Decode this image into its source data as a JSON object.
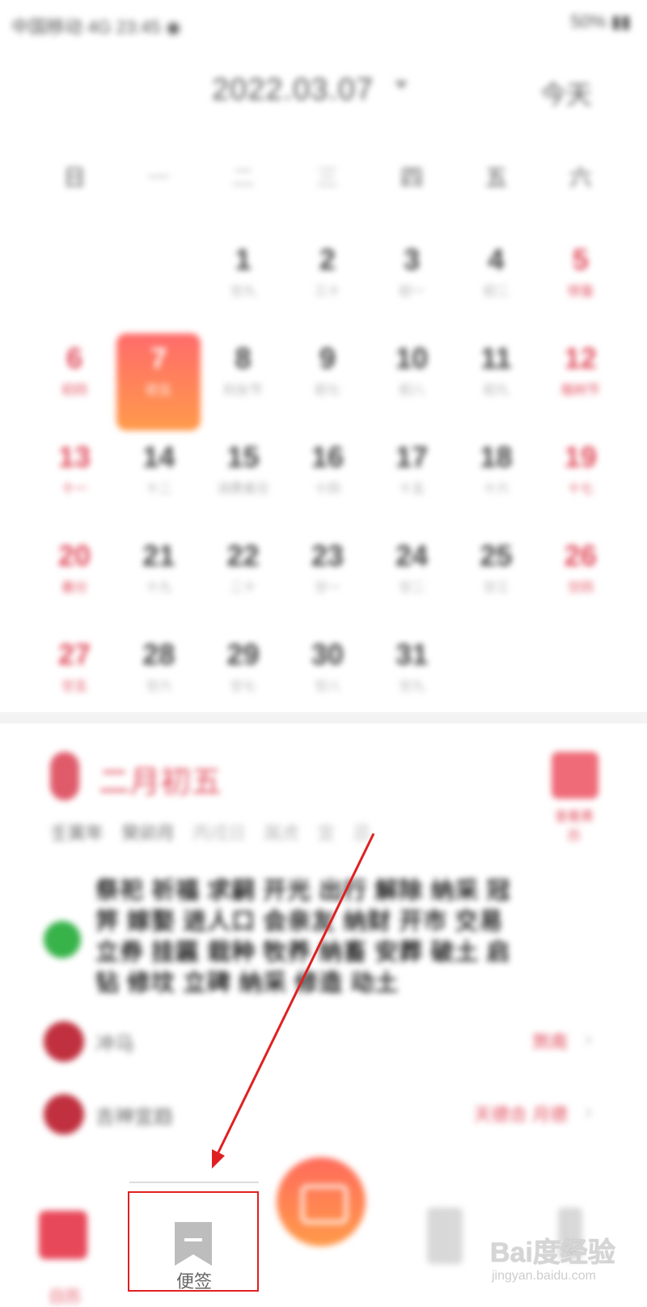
{
  "status_bar": {
    "left_text": "中国移动 4G 23:45 ◉",
    "right_text": "50% ▮▮"
  },
  "header": {
    "date": "2022.03.07",
    "today_button": "今天"
  },
  "weekdays": [
    "日",
    "一",
    "二",
    "三",
    "四",
    "五",
    "六"
  ],
  "calendar": {
    "rows": [
      [
        {
          "day": "",
          "sub": "",
          "weekend": false
        },
        {
          "day": "",
          "sub": "",
          "weekend": false
        },
        {
          "day": "1",
          "sub": "廿九",
          "weekend": false
        },
        {
          "day": "2",
          "sub": "三十",
          "weekend": false
        },
        {
          "day": "3",
          "sub": "初一",
          "weekend": false
        },
        {
          "day": "4",
          "sub": "初二",
          "weekend": false
        },
        {
          "day": "5",
          "sub": "惊蛰",
          "weekend": true
        }
      ],
      [
        {
          "day": "6",
          "sub": "初四",
          "weekend": true
        },
        {
          "day": "7",
          "sub": "初五",
          "weekend": false,
          "selected": true
        },
        {
          "day": "8",
          "sub": "妇女节",
          "weekend": false
        },
        {
          "day": "9",
          "sub": "初七",
          "weekend": false
        },
        {
          "day": "10",
          "sub": "初八",
          "weekend": false
        },
        {
          "day": "11",
          "sub": "初九",
          "weekend": false
        },
        {
          "day": "12",
          "sub": "植树节",
          "weekend": true
        }
      ],
      [
        {
          "day": "13",
          "sub": "十一",
          "weekend": true
        },
        {
          "day": "14",
          "sub": "十二",
          "weekend": false
        },
        {
          "day": "15",
          "sub": "消费者日",
          "weekend": false
        },
        {
          "day": "16",
          "sub": "十四",
          "weekend": false
        },
        {
          "day": "17",
          "sub": "十五",
          "weekend": false
        },
        {
          "day": "18",
          "sub": "十六",
          "weekend": false
        },
        {
          "day": "19",
          "sub": "十七",
          "weekend": true
        }
      ],
      [
        {
          "day": "20",
          "sub": "春分",
          "weekend": true
        },
        {
          "day": "21",
          "sub": "十九",
          "weekend": false
        },
        {
          "day": "22",
          "sub": "二十",
          "weekend": false
        },
        {
          "day": "23",
          "sub": "廿一",
          "weekend": false
        },
        {
          "day": "24",
          "sub": "廿二",
          "weekend": false
        },
        {
          "day": "25",
          "sub": "廿三",
          "weekend": false
        },
        {
          "day": "26",
          "sub": "廿四",
          "weekend": true
        }
      ],
      [
        {
          "day": "27",
          "sub": "廿五",
          "weekend": true
        },
        {
          "day": "28",
          "sub": "廿六",
          "weekend": false
        },
        {
          "day": "29",
          "sub": "廿七",
          "weekend": false
        },
        {
          "day": "30",
          "sub": "廿八",
          "weekend": false
        },
        {
          "day": "31",
          "sub": "廿九",
          "weekend": false
        },
        {
          "day": "",
          "sub": "",
          "weekend": false
        },
        {
          "day": "",
          "sub": "",
          "weekend": false
        }
      ]
    ]
  },
  "fortune": {
    "title": "二月初五",
    "badge_label": "查看黄历",
    "tags": [
      "壬寅年",
      "癸卯月",
      "丙戌日",
      "属虎",
      "宜",
      "忌"
    ],
    "good_text": "祭祀 祈福 求嗣 开光 出行 解除 纳采 冠笄 嫁娶 进人口 会亲友 纳财 开市 交易 立券 挂匾 栽种 牧养 纳畜 安葬 破土 启钻 修坟 立碑 纳采 修造 动土"
  },
  "info_rows": [
    {
      "label": "冲马",
      "value": "煞南"
    },
    {
      "label": "吉神宜趋",
      "value": "天德合 月德"
    }
  ],
  "bottom_nav": {
    "calendar_label": "日历",
    "notes_label": "便签"
  },
  "watermark": {
    "main": "Bai度经验",
    "sub": "jingyan.baidu.com"
  },
  "colors": {
    "accent_red": "#e04a5a",
    "selected_gradient_start": "#ff6b6b",
    "selected_gradient_end": "#ff9a4a",
    "good_green": "#37b34a",
    "annotation_red": "#e02020"
  }
}
